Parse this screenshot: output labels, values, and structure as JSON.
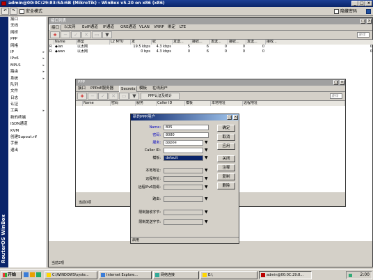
{
  "window": {
    "title": "admin@00:0C:29:83:5A:6B (MikroTik) - WinBox v5.20 on x86 (x86)"
  },
  "toolbar": {
    "undo": "↶",
    "redo": "↷",
    "safe_mode": "安全模式",
    "hide_passwords": "隐藏密码"
  },
  "sidebar": {
    "vertical_label": "RouterOS WinBox",
    "items": [
      {
        "label": "接口",
        "arrow": ""
      },
      {
        "label": "无线",
        "arrow": ""
      },
      {
        "label": "网桥",
        "arrow": ""
      },
      {
        "label": "PPP",
        "arrow": ""
      },
      {
        "label": "网格",
        "arrow": ""
      },
      {
        "label": "IP",
        "arrow": "▸"
      },
      {
        "label": "IPv6",
        "arrow": "▸"
      },
      {
        "label": "MPLS",
        "arrow": "▸"
      },
      {
        "label": "路由",
        "arrow": "▸"
      },
      {
        "label": "系统",
        "arrow": "▸"
      },
      {
        "label": "队列",
        "arrow": ""
      },
      {
        "label": "文件",
        "arrow": ""
      },
      {
        "label": "日志",
        "arrow": ""
      },
      {
        "label": "认证",
        "arrow": ""
      },
      {
        "label": "工具",
        "arrow": "▸"
      },
      {
        "label": "新的终端",
        "arrow": ""
      },
      {
        "label": "ISDN通道",
        "arrow": ""
      },
      {
        "label": "KVM",
        "arrow": ""
      },
      {
        "label": "创建Supout.rif",
        "arrow": ""
      },
      {
        "label": "手册",
        "arrow": ""
      },
      {
        "label": "退出",
        "arrow": ""
      }
    ]
  },
  "iface_window": {
    "title": "接口列表",
    "tabs": [
      "接口",
      "以太网",
      "EoIP通道",
      "IP通道",
      "GRE通道",
      "VLAN",
      "VRRP",
      "绑定",
      "LTE"
    ],
    "find": "查找",
    "columns": [
      "Name",
      "类型",
      "L2 MTU",
      "发",
      "收",
      "发送...",
      "接收...",
      "发送...",
      "接收...",
      "发送...",
      "接收..."
    ],
    "rows": [
      {
        "flag": "R",
        "name": "◆lan",
        "type": "以太网",
        "mtu": "",
        "tx": "19.5 kbps",
        "rx": "4.3 kbps",
        "c1": "5",
        "c2": "6",
        "c3": "0",
        "c4": "0",
        "c5": "0",
        "c6": "0"
      },
      {
        "flag": "R",
        "name": "◆wan",
        "type": "以太网",
        "mtu": "",
        "tx": "0 bps",
        "rx": "4.3 kbps",
        "c1": "0",
        "c2": "6",
        "c3": "0",
        "c4": "0",
        "c5": "0",
        "c6": "0"
      }
    ],
    "status": "当前2项"
  },
  "ppp_window": {
    "title": "PPP",
    "tabs": [
      "接口",
      "PPPoE服务器",
      "Secrets",
      "模板",
      "在线用户"
    ],
    "auth_button": "PPP认证及统计",
    "find": "查找",
    "columns": [
      "Name",
      "密码",
      "服务",
      "Caller ID",
      "模板",
      "本地地址",
      "远程地址"
    ],
    "status": "当前0项"
  },
  "new_user": {
    "title": "新的PPP用户",
    "fields": {
      "name_label": "Name:",
      "name_value": "805",
      "password_label": "密码:",
      "password_value": "8080",
      "service_label": "服务:",
      "service_value": "pppoe",
      "callerid_label": "Caller ID:",
      "callerid_value": "",
      "profile_label": "模板:",
      "profile_value": "default",
      "local_label": "本地地址:",
      "remote_label": "远程地址:",
      "ipv6_label": "远程IPv6前缀:",
      "routes_label": "路由:",
      "limit_in_label": "限制接收字节:",
      "limit_out_label": "限制发送字节:"
    },
    "buttons": [
      "确定",
      "取消",
      "应用",
      "关闭",
      "注释",
      "复制",
      "删除"
    ],
    "status": "启用"
  },
  "taskbar": {
    "start": "开始",
    "tasks": [
      "C:\\WINDOWS\\syste...",
      "Internet Explore...",
      "网络连接",
      "E:\\",
      "admin@00:0C:29:8..."
    ],
    "clock": "2:00"
  }
}
